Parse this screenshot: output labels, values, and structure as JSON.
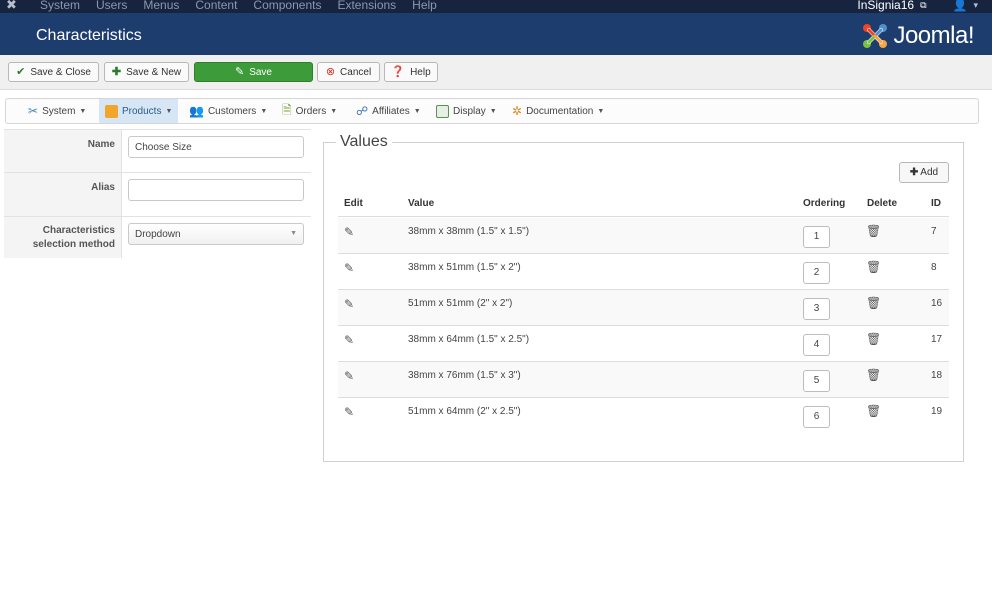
{
  "topbar": {
    "menu": [
      "System",
      "Users",
      "Menus",
      "Content",
      "Components",
      "Extensions",
      "Help"
    ],
    "site_name": "InSignia16",
    "user_caret": "▾"
  },
  "header": {
    "title": "Characteristics",
    "brand": "Joomla!"
  },
  "toolbar": {
    "save_close": "Save & Close",
    "save_new": "Save & New",
    "save": "Save",
    "cancel": "Cancel",
    "help": "Help"
  },
  "subnav": [
    {
      "label": "System",
      "icon": "tools-icon",
      "color": "#3b7fc4"
    },
    {
      "label": "Products",
      "icon": "products-icon",
      "color": "#f1a52a"
    },
    {
      "label": "Customers",
      "icon": "customers-icon",
      "color": "#3f86c7"
    },
    {
      "label": "Orders",
      "icon": "orders-icon",
      "color": "#7ea03a"
    },
    {
      "label": "Affiliates",
      "icon": "affiliates-icon",
      "color": "#3a6fb5"
    },
    {
      "label": "Display",
      "icon": "display-icon",
      "color": "#5b8f54"
    },
    {
      "label": "Documentation",
      "icon": "documentation-icon",
      "color": "#d98a24"
    }
  ],
  "form": {
    "name_label": "Name",
    "name_value": "Choose Size",
    "alias_label": "Alias",
    "alias_value": "",
    "method_label": "Characteristics selection method",
    "method_value": "Dropdown"
  },
  "values": {
    "legend": "Values",
    "add_label": "Add",
    "headers": {
      "edit": "Edit",
      "value": "Value",
      "ordering": "Ordering",
      "delete": "Delete",
      "id": "ID"
    },
    "rows": [
      {
        "value": "38mm x 38mm (1.5\" x 1.5\")",
        "ordering": "1",
        "id": "7"
      },
      {
        "value": "38mm x 51mm (1.5\" x 2\")",
        "ordering": "2",
        "id": "8"
      },
      {
        "value": "51mm x 51mm (2\" x 2\")",
        "ordering": "3",
        "id": "16"
      },
      {
        "value": "38mm x 64mm (1.5\" x 2.5\")",
        "ordering": "4",
        "id": "17"
      },
      {
        "value": "38mm x 76mm (1.5\" x 3\")",
        "ordering": "5",
        "id": "18"
      },
      {
        "value": "51mm x 64mm (2\" x 2.5\")",
        "ordering": "6",
        "id": "19"
      }
    ]
  }
}
